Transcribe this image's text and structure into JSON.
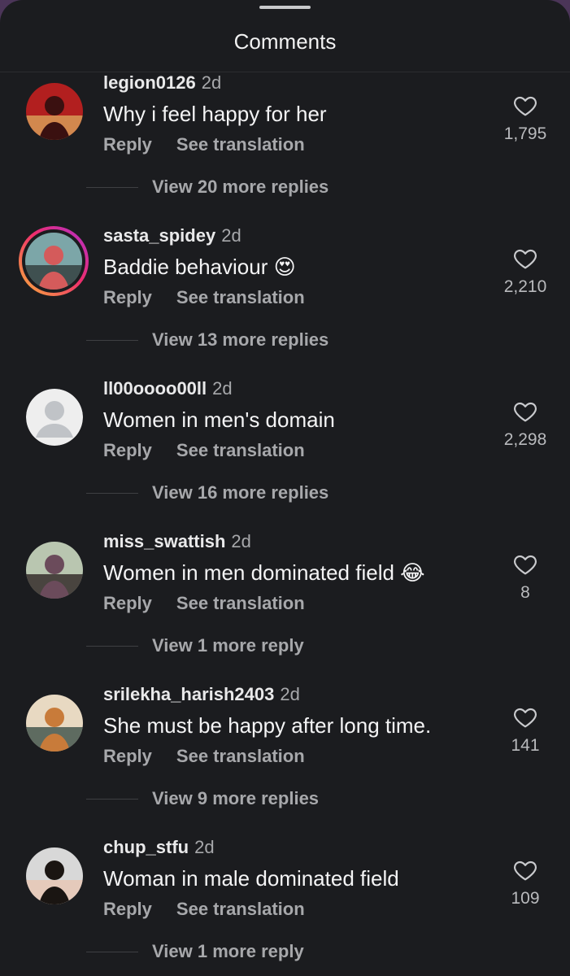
{
  "header": {
    "title": "Comments"
  },
  "comments": [
    {
      "username": "legion0126",
      "time": "2d",
      "text": "Why i feel happy for her",
      "emoji": "",
      "reply_label": "Reply",
      "translate_label": "See translation",
      "likes": "1,795",
      "view_replies": "View 20 more replies",
      "avatar": {
        "kind": "photo",
        "icon": "user-avatar-theater",
        "colors": [
          "#b21f1f",
          "#3a1010",
          "#d9a25a"
        ]
      }
    },
    {
      "username": "sasta_spidey",
      "time": "2d",
      "text": "Baddie behaviour",
      "emoji": "😍",
      "reply_label": "Reply",
      "translate_label": "See translation",
      "likes": "2,210",
      "view_replies": "View 13 more replies",
      "avatar": {
        "kind": "story-ring",
        "icon": "user-avatar-mask",
        "colors": [
          "#7ca6a8",
          "#d45b5b",
          "#2f3b3a"
        ]
      }
    },
    {
      "username": "ll00oooo00ll",
      "time": "2d",
      "text": "Women in men's domain",
      "emoji": "",
      "reply_label": "Reply",
      "translate_label": "See translation",
      "likes": "2,298",
      "view_replies": "View 16 more replies",
      "avatar": {
        "kind": "default",
        "icon": "default-user-icon",
        "colors": [
          "#eeeeee",
          "#c0c3c7"
        ]
      }
    },
    {
      "username": "miss_swattish",
      "time": "2d",
      "text": "Women in men dominated field",
      "emoji": "😂",
      "reply_label": "Reply",
      "translate_label": "See translation",
      "likes": "8",
      "view_replies": "View 1 more reply",
      "avatar": {
        "kind": "photo",
        "icon": "user-avatar-woman",
        "colors": [
          "#b9c6b0",
          "#6b4b5b",
          "#2d2323"
        ]
      }
    },
    {
      "username": "srilekha_harish2403",
      "time": "2d",
      "text": "She must be happy after long time.",
      "emoji": "",
      "reply_label": "Reply",
      "translate_label": "See translation",
      "likes": "141",
      "view_replies": "View 9 more replies",
      "avatar": {
        "kind": "photo",
        "icon": "user-avatar-party",
        "colors": [
          "#e8d9c2",
          "#c87b3a",
          "#3b4f47"
        ]
      }
    },
    {
      "username": "chup_stfu",
      "time": "2d",
      "text": "Woman in male dominated field",
      "emoji": "",
      "reply_label": "Reply",
      "translate_label": "See translation",
      "likes": "109",
      "view_replies": "View 1 more reply",
      "avatar": {
        "kind": "photo",
        "icon": "user-avatar-portrait",
        "colors": [
          "#d8d8d8",
          "#1a1512",
          "#e9c7b4"
        ]
      }
    }
  ]
}
